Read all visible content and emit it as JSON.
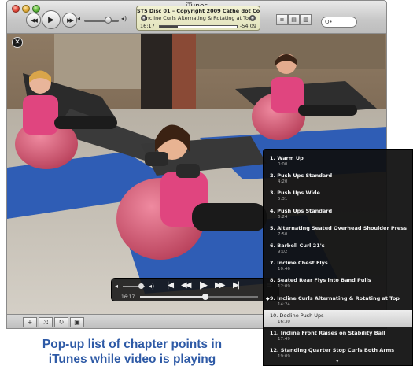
{
  "window": {
    "title": "iTunes"
  },
  "lcd": {
    "line1": "ST5 Disc 01 – Copyright 2009 Cathe dot Com",
    "line2": "Incline Curls Alternating & Rotating at Top",
    "elapsed": "16:17",
    "remaining": "-54:09",
    "progress": 0.23
  },
  "search": {
    "placeholder": "Q•"
  },
  "icons": {
    "close": "close-icon",
    "back": "rewind-icon",
    "play": "play-icon",
    "forward": "fast-forward-icon",
    "volume_low": "speaker-low-icon",
    "volume_high": "speaker-high-icon"
  },
  "controller": {
    "elapsed": "16:17",
    "progress": 0.55
  },
  "chapters": {
    "items": [
      {
        "title": "1.  Warm Up",
        "time": "0:00"
      },
      {
        "title": "2.  Push Ups Standard",
        "time": "4:20"
      },
      {
        "title": "3.  Push Ups Wide",
        "time": "5:31"
      },
      {
        "title": "4.  Push Ups Standard",
        "time": "6:24"
      },
      {
        "title": "5.  Alternating Seated Overhead Shoulder Press",
        "time": "7:50"
      },
      {
        "title": "6.  Barbell Curl 21's",
        "time": "9:02"
      },
      {
        "title": "7.  Incline Chest Flys",
        "time": "10:46"
      },
      {
        "title": "8.  Seated Rear Flys into Band Pulls",
        "time": "12:09"
      },
      {
        "title": "9.  Incline Curls Alternating & Rotating at Top",
        "time": "14:24"
      },
      {
        "title": "10.  Decline Push Ups",
        "time": "16:30"
      },
      {
        "title": "11.  Incline Front Raises on Stability Ball",
        "time": "17:49"
      },
      {
        "title": "12.  Standing Quarter Stop Curls Both Arms",
        "time": "19:09"
      }
    ],
    "current_index": 8,
    "hover_index": 9,
    "more_arrow": "▾"
  },
  "caption": {
    "line1": "Pop-up list of chapter points in",
    "line2": "iTunes while video is playing"
  },
  "colors": {
    "caption": "#2e5aa6",
    "popup_bg": "#101010",
    "lcd_bg": "#e8e9c6",
    "ball": "#d4566f",
    "mat": "#2f5db5"
  }
}
